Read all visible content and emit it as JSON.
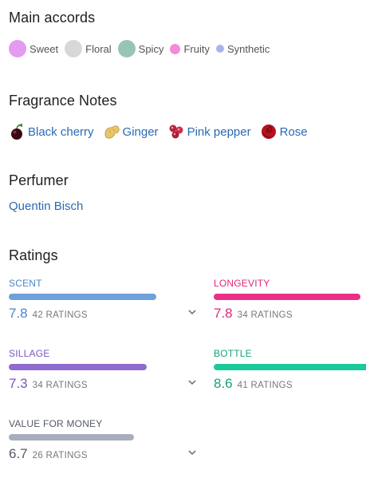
{
  "accords": {
    "title": "Main accords",
    "items": [
      {
        "label": "Sweet",
        "color": "#e39af0",
        "size": 22
      },
      {
        "label": "Floral",
        "color": "#d8d8d8",
        "size": 22
      },
      {
        "label": "Spicy",
        "color": "#98c4b8",
        "size": 22
      },
      {
        "label": "Fruity",
        "color": "#f38bd8",
        "size": 13
      },
      {
        "label": "Synthetic",
        "color": "#a9b4ee",
        "size": 10
      }
    ]
  },
  "notes": {
    "title": "Fragrance Notes",
    "items": [
      {
        "label": "Black cherry",
        "icon": "black-cherry-icon"
      },
      {
        "label": "Ginger",
        "icon": "ginger-icon"
      },
      {
        "label": "Pink pepper",
        "icon": "pink-pepper-icon"
      },
      {
        "label": "Rose",
        "icon": "rose-icon"
      }
    ]
  },
  "perfumer": {
    "title": "Perfumer",
    "name": "Quentin Bisch"
  },
  "ratings": {
    "title": "Ratings",
    "items": [
      {
        "label": "SCENT",
        "value": "7.8",
        "count": "42 RATINGS",
        "color": "#4a86c8",
        "bar": "#6ea0da"
      },
      {
        "label": "LONGEVITY",
        "value": "7.8",
        "count": "34 RATINGS",
        "color": "#e0287a",
        "bar": "#ec2f86"
      },
      {
        "label": "SILLAGE",
        "value": "7.3",
        "count": "34 RATINGS",
        "color": "#7a57c2",
        "bar": "#8f6bd0"
      },
      {
        "label": "BOTTLE",
        "value": "8.6",
        "count": "41 RATINGS",
        "color": "#14a37a",
        "bar": "#1cc99a"
      },
      {
        "label": "VALUE FOR MONEY",
        "value": "6.7",
        "count": "26 RATINGS",
        "color": "#555a6a",
        "bar": "#a7adbd"
      }
    ]
  }
}
